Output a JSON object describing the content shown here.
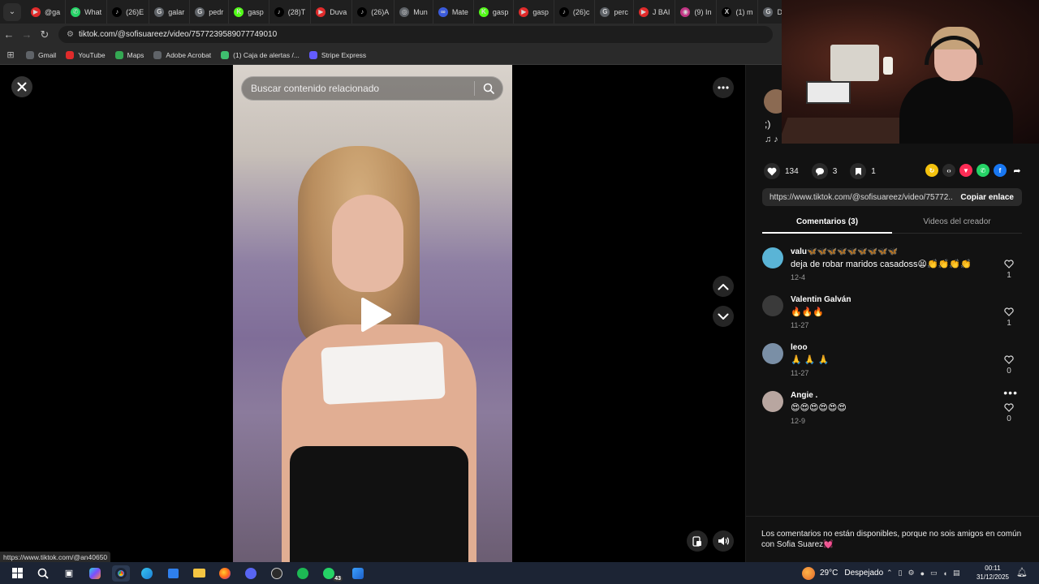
{
  "browser": {
    "tabs": [
      {
        "label": "@ga",
        "color": "#e02b2b",
        "glyph": "▶"
      },
      {
        "label": "What",
        "color": "#25d366",
        "glyph": "✆"
      },
      {
        "label": "(26)E",
        "color": "#000000",
        "glyph": "♪"
      },
      {
        "label": "galar",
        "color": "#5f6368",
        "glyph": "G"
      },
      {
        "label": "pedr",
        "color": "#5f6368",
        "glyph": "G"
      },
      {
        "label": "gasp",
        "color": "#53fc18",
        "glyph": "K"
      },
      {
        "label": "(28)T",
        "color": "#000000",
        "glyph": "♪"
      },
      {
        "label": "Duva",
        "color": "#e02b2b",
        "glyph": "▶"
      },
      {
        "label": "(26)A",
        "color": "#000000",
        "glyph": "♪"
      },
      {
        "label": "Mun",
        "color": "#5f6368",
        "glyph": "◎"
      },
      {
        "label": "Mate",
        "color": "#3b5bdb",
        "glyph": "∞"
      },
      {
        "label": "gasp",
        "color": "#53fc18",
        "glyph": "K"
      },
      {
        "label": "gasp",
        "color": "#e02b2b",
        "glyph": "▶"
      },
      {
        "label": "(26)c",
        "color": "#000000",
        "glyph": "♪"
      },
      {
        "label": "perc",
        "color": "#5f6368",
        "glyph": "G"
      },
      {
        "label": "J BAI",
        "color": "#e02b2b",
        "glyph": "▶"
      },
      {
        "label": "(9) In",
        "color": "#c13584",
        "glyph": "◉"
      },
      {
        "label": "(1) m",
        "color": "#000000",
        "glyph": "X"
      },
      {
        "label": "De",
        "color": "#5f6368",
        "glyph": "G"
      }
    ],
    "url": "tiktok.com/@sofisuareez/video/7577239589077749010",
    "bookmarks": [
      {
        "label": "Gmail",
        "color": "#5f6368"
      },
      {
        "label": "YouTube",
        "color": "#e02b2b"
      },
      {
        "label": "Maps",
        "color": "#34a853"
      },
      {
        "label": "Adobe Acrobat",
        "color": "#5f6368"
      },
      {
        "label": "(1) Caja de alertas /...",
        "color": "#3fbf6f"
      },
      {
        "label": "Stripe Express",
        "color": "#635bff"
      }
    ]
  },
  "player": {
    "search_placeholder": "Buscar contenido relacionado"
  },
  "panel": {
    "description": ";)",
    "music": "♫ ♪",
    "actions": {
      "likes": "134",
      "comments": "3",
      "saves": "1"
    },
    "share_link": "https://www.tiktok.com/@sofisuareez/video/75772...",
    "copy_label": "Copiar enlace",
    "tabs": {
      "comments": "Comentarios (3)",
      "creator_videos": "Videos del creador"
    },
    "comments": [
      {
        "user": "valu🦋🦋🦋🦋🦋🦋🦋🦋🦋",
        "text": "deja de robar maridos casadoss😫👏👏👏👏",
        "date": "12-4",
        "likes": "1",
        "avatar_color": "#5ab4d6"
      },
      {
        "user": "Valentin Galván",
        "text": "🔥🔥🔥",
        "date": "11-27",
        "likes": "1",
        "avatar_color": "#3a3a3a"
      },
      {
        "user": "leoo",
        "text": "🙏 🙏 🙏",
        "date": "11-27",
        "likes": "0",
        "avatar_color": "#7a8fa6"
      },
      {
        "user": "Angie .",
        "text": "😍😍😍😍😍😍",
        "date": "12-9",
        "likes": "0",
        "avatar_color": "#b8a6a0"
      }
    ],
    "notice": "Los comentarios no están disponibles, porque no sois amigos en común con Sofia Suarez💓"
  },
  "status_url": "https://www.tiktok.com/@an40650",
  "taskbar": {
    "weather_temp": "29°C",
    "weather_desc": "Despejado",
    "time": "00:11",
    "date": "31/12/2025",
    "whatsapp_badge": "43"
  }
}
